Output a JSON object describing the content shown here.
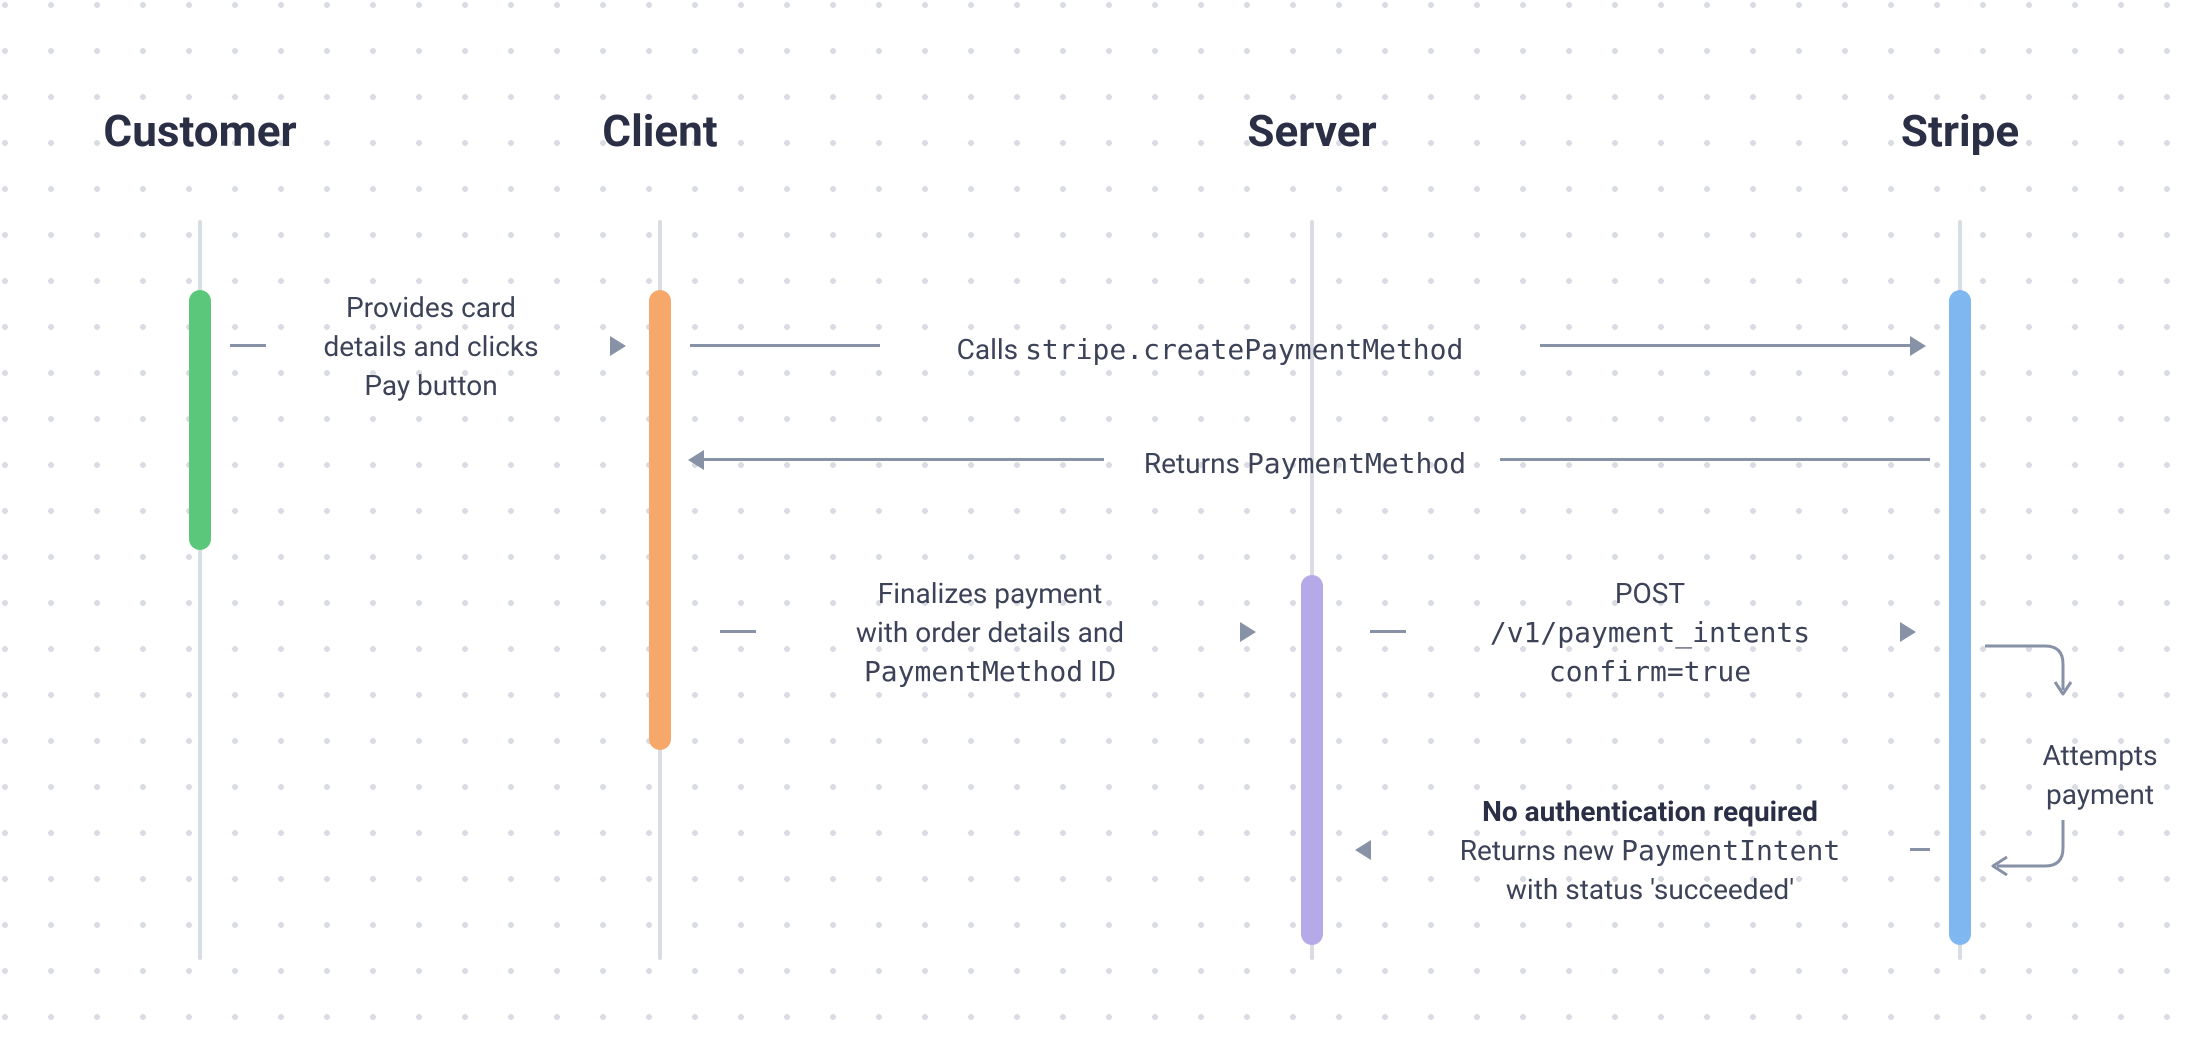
{
  "lanes": {
    "customer": "Customer",
    "client": "Client",
    "server": "Server",
    "stripe": "Stripe"
  },
  "colors": {
    "customer": "#5bc77a",
    "client": "#f6a86b",
    "server": "#b6a9e8",
    "stripe": "#7fb7f0",
    "arrow": "#8892a6"
  },
  "messages": {
    "m1_l1": "Provides card",
    "m1_l2": "details and clicks",
    "m1_l3": "Pay button",
    "m2_pre": "Calls ",
    "m2_code": "stripe.createPaymentMethod",
    "m3_pre": "Returns ",
    "m3_code": "PaymentMethod",
    "m4_l1": "Finalizes payment",
    "m4_l2": "with order details and",
    "m4_l3_code": "PaymentMethod",
    "m4_l3_suffix": " ID",
    "m5_l1": "POST",
    "m5_l2": "/v1/payment_intents",
    "m5_l3": "confirm=true",
    "loop_l1": "Attempts",
    "loop_l2": "payment",
    "m6_l1": "No authentication required",
    "m6_l2_pre": "Returns new ",
    "m6_l2_code": "PaymentIntent",
    "m6_l3": "with status 'succeeded'"
  }
}
